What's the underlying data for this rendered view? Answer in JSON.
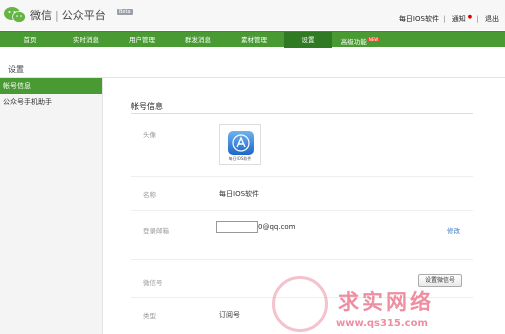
{
  "header": {
    "brand_name": "微信",
    "brand_sub": "公众平台",
    "beta": "Beta",
    "user": "每日IOS软件",
    "notify": "通知",
    "logout": "退出"
  },
  "nav": {
    "items": [
      "首页",
      "实时消息",
      "用户管理",
      "群发消息",
      "素材管理",
      "设置",
      "高级功能"
    ],
    "active": "设置",
    "new_badge": "NEW"
  },
  "breadcrumb": "设置",
  "sidebar": {
    "items": [
      "帐号信息",
      "公众号手机助手"
    ],
    "active": "帐号信息"
  },
  "account": {
    "title": "帐号信息",
    "avatar_label": "头像",
    "avatar_caption": "每日IOS软件",
    "name_label": "名称",
    "name_value": "每日IOS软件",
    "email_label": "登录邮箱",
    "email_suffix": "0@qq.com",
    "email_edit": "修改",
    "wechat_id_label": "微信号",
    "wechat_id_button": "设置微信号",
    "type_label": "类型",
    "type_value": "订阅号"
  },
  "watermark": {
    "text": "求实网络",
    "url": "www.qs315.com"
  },
  "colors": {
    "nav_green": "#4a9a34",
    "nav_active": "#2f7a22",
    "link_blue": "#3a78c2"
  }
}
